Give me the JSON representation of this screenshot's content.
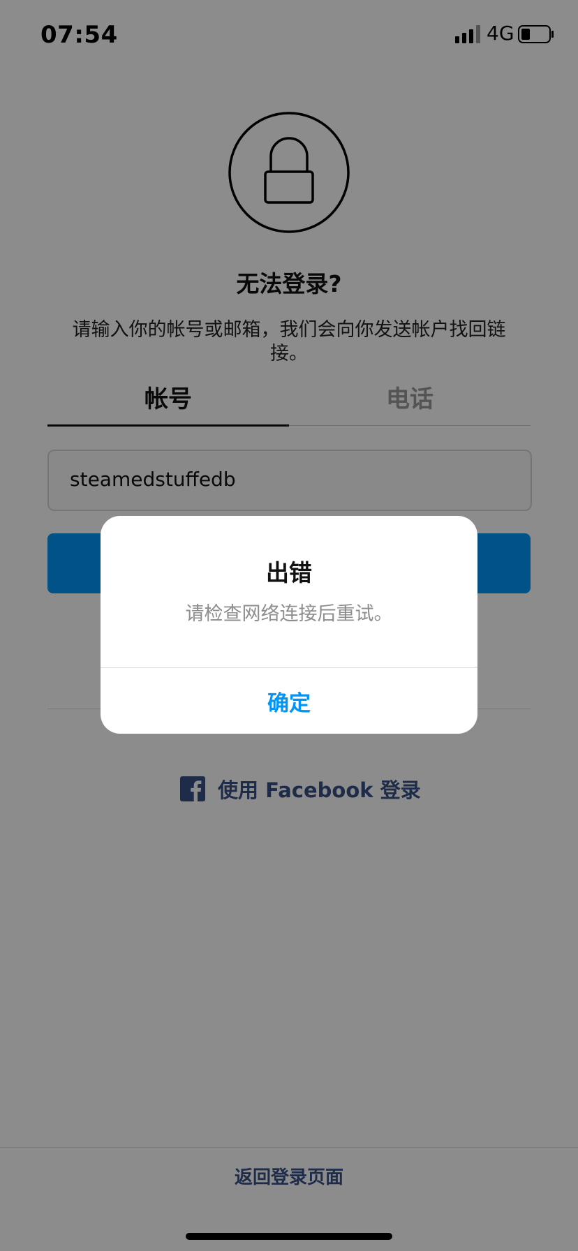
{
  "status_bar": {
    "time": "07:54",
    "network": "4G"
  },
  "screen": {
    "title": "无法登录?",
    "description": "请输入你的帐号或邮箱，我们会向你发送帐户找回链接。",
    "tabs": [
      {
        "label": "帐号"
      },
      {
        "label": "电话"
      }
    ],
    "account_input": {
      "value": "steamedstuffedb"
    },
    "facebook_login_label": "使用 Facebook 登录",
    "back_to_login": "返回登录页面"
  },
  "alert": {
    "title": "出错",
    "message": "请检查网络连接后重试。",
    "ok_label": "确定"
  },
  "colors": {
    "accent": "#0095f6",
    "facebook": "#385185"
  },
  "icons": [
    "lock-icon",
    "signal-icon",
    "battery-icon",
    "facebook-icon"
  ]
}
